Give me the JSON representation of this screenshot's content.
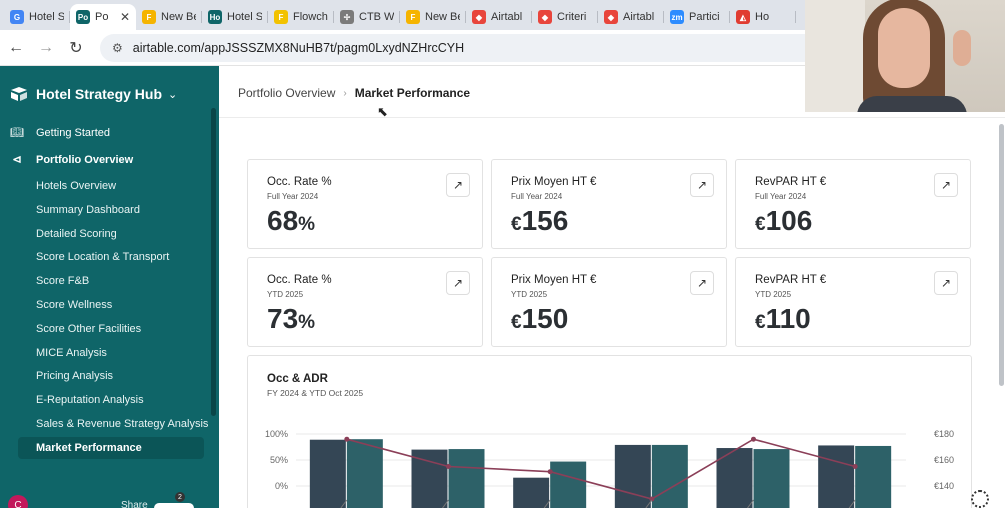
{
  "browser": {
    "tabs": [
      {
        "label": "Hotel S",
        "fav_text": "G",
        "fav_color": "#4285f4",
        "active": false
      },
      {
        "label": "Po",
        "fav_text": "Po",
        "fav_color": "#0f6568",
        "active": true
      },
      {
        "label": "New Be",
        "fav_text": "F",
        "fav_color": "#f5b400",
        "active": false
      },
      {
        "label": "Hotel S",
        "fav_text": "Ho",
        "fav_color": "#0f6568",
        "active": false
      },
      {
        "label": "Flowch",
        "fav_text": "F",
        "fav_color": "#f2c200",
        "active": false
      },
      {
        "label": "CTB W",
        "fav_text": "✢",
        "fav_color": "#7b7b7b",
        "active": false
      },
      {
        "label": "New Be",
        "fav_text": "F",
        "fav_color": "#f5b400",
        "active": false
      },
      {
        "label": "Airtabl",
        "fav_text": "◆",
        "fav_color": "#e8453c",
        "active": false
      },
      {
        "label": "Criteri",
        "fav_text": "◆",
        "fav_color": "#e8453c",
        "active": false
      },
      {
        "label": "Airtabl",
        "fav_text": "◆",
        "fav_color": "#e8453c",
        "active": false
      },
      {
        "label": "Partici",
        "fav_text": "zm",
        "fav_color": "#2d8cff",
        "active": false
      },
      {
        "label": "Ho",
        "fav_text": "◭",
        "fav_color": "#e03c31",
        "active": false
      }
    ],
    "url": "airtable.com/appJSSSZMX8NuHB7t/pagm0LxydNZHrcCYH"
  },
  "sidebar": {
    "brand": "Hotel Strategy Hub",
    "top_items": [
      {
        "label": "Getting Started",
        "icon": "book-icon"
      },
      {
        "label": "Portfolio Overview",
        "icon": "megaphone-icon"
      }
    ],
    "sub_items": [
      "Hotels Overview",
      "Summary Dashboard",
      "Detailed Scoring",
      "Score Location & Transport",
      "Score F&B",
      "Score Wellness",
      "Score Other Facilities",
      "MICE Analysis",
      "Pricing Analysis",
      "E-Reputation Analysis",
      "Sales & Revenue Strategy Analysis",
      "Market Performance"
    ],
    "active_item": "Market Performance",
    "footer": {
      "avatar": "C",
      "share": "Share",
      "badge": "2"
    }
  },
  "breadcrumb": {
    "parent": "Portfolio Overview",
    "current": "Market Performance"
  },
  "kpis": [
    {
      "title": "Occ. Rate %",
      "period": "Full Year 2024",
      "prefix": "",
      "value": "68",
      "suffix": "%"
    },
    {
      "title": "Prix Moyen HT €",
      "period": "Full Year 2024",
      "prefix": "€",
      "value": "156",
      "suffix": ""
    },
    {
      "title": "RevPAR HT €",
      "period": "Full Year 2024",
      "prefix": "€",
      "value": "106",
      "suffix": ""
    },
    {
      "title": "Occ. Rate %",
      "period": "YTD 2025",
      "prefix": "",
      "value": "73",
      "suffix": "%"
    },
    {
      "title": "Prix Moyen HT €",
      "period": "YTD 2025",
      "prefix": "€",
      "value": "150",
      "suffix": ""
    },
    {
      "title": "RevPAR HT €",
      "period": "YTD 2025",
      "prefix": "€",
      "value": "110",
      "suffix": ""
    }
  ],
  "chart_data": {
    "type": "bar",
    "title": "Occ & ADR",
    "subtitle": "FY 2024 & YTD Oct 2025",
    "y_left_ticks": [
      "100%",
      "50%",
      "0%"
    ],
    "y_right_ticks": [
      "€180",
      "€160",
      "€140"
    ],
    "ylim_left": [
      0,
      100
    ],
    "ylim_right": [
      130,
      180
    ],
    "categories": [
      "",
      "",
      "",
      "",
      "",
      ""
    ],
    "series": [
      {
        "type": "bar",
        "color": "#344655",
        "values": [
          89,
          70,
          16,
          79,
          73,
          78
        ]
      },
      {
        "type": "bar",
        "color": "#2d6168",
        "values": [
          90,
          71,
          47,
          79,
          71,
          77
        ]
      },
      {
        "type": "line",
        "color": "#8b3f58",
        "values": [
          176,
          155,
          151,
          130,
          176,
          155
        ]
      }
    ],
    "grid": true
  }
}
